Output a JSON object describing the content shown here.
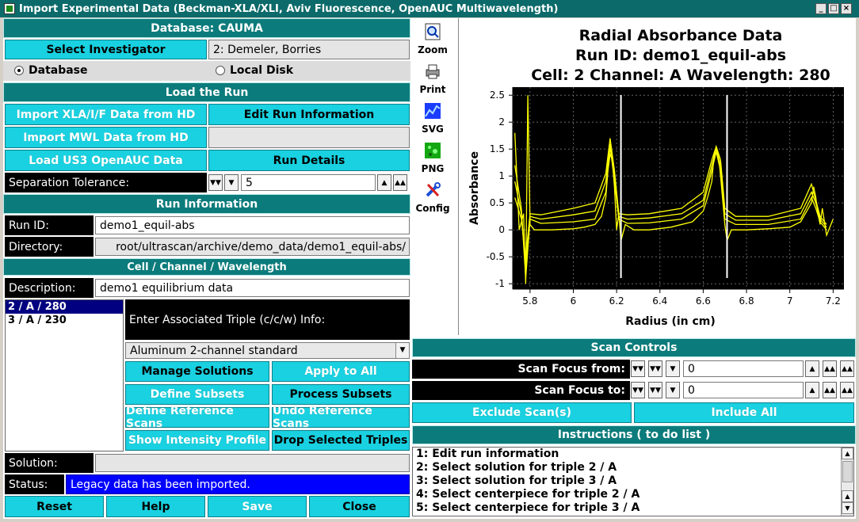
{
  "window": {
    "title": "Import Experimental Data (Beckman-XLA/XLI, Aviv Fluorescence, OpenAUC Multiwavelength)"
  },
  "left": {
    "database_header": "Database: CAUMA",
    "select_investigator": "Select Investigator",
    "investigator_value": "2: Demeler, Borries",
    "radio_database": "Database",
    "radio_local": "Local Disk",
    "load_run_header": "Load the Run",
    "import_xla": "Import XLA/I/F Data from HD",
    "edit_run_info": "Edit Run Information",
    "import_mwl": "Import MWL Data from HD",
    "load_us3": "Load US3 OpenAUC Data",
    "run_details": "Run Details",
    "separation_label": "Separation Tolerance:",
    "separation_value": "5",
    "run_info_header": "Run Information",
    "run_id_label": "Run ID:",
    "run_id_value": "demo1_equil-abs",
    "directory_label": "Directory:",
    "directory_value": "root/ultrascan/archive/demo_data/demo1_equil-abs/",
    "ccw_header": "Cell / Channel / Wavelength",
    "description_label": "Description:",
    "description_value": "demo1 equilibrium data",
    "triples": [
      "2 / A / 280",
      "3 / A / 230"
    ],
    "triple_info_label": "Enter Associated Triple (c/c/w) Info:",
    "centerpiece_value": "Aluminum 2-channel standard",
    "manage_solutions": "Manage Solutions",
    "apply_to_all": "Apply to All",
    "define_subsets": "Define Subsets",
    "process_subsets": "Process Subsets",
    "define_ref_scans": "Define Reference Scans",
    "undo_ref_scans": "Undo Reference Scans",
    "show_intensity": "Show Intensity Profile",
    "drop_triples": "Drop Selected Triples",
    "solution_label": "Solution:",
    "status_label": "Status:",
    "status_value": "Legacy data has been imported.",
    "reset": "Reset",
    "help": "Help",
    "save": "Save",
    "close": "Close"
  },
  "tools": [
    {
      "label": "Zoom",
      "icon": "zoom-icon"
    },
    {
      "label": "Print",
      "icon": "print-icon"
    },
    {
      "label": "SVG",
      "icon": "svg-icon"
    },
    {
      "label": "PNG",
      "icon": "png-icon"
    },
    {
      "label": "Config",
      "icon": "config-icon"
    }
  ],
  "right": {
    "scan_controls_header": "Scan Controls",
    "scan_from_label": "Scan Focus from:",
    "scan_from_value": "0",
    "scan_to_label": "Scan Focus to:",
    "scan_to_value": "0",
    "exclude_scans": "Exclude Scan(s)",
    "include_all": "Include All",
    "instructions_header": "Instructions ( to do list )",
    "instructions": [
      "1: Edit run information",
      "2: Select solution for triple 2 / A",
      "3: Select solution for triple 3 / A",
      "4: Select centerpiece for triple 2 / A",
      "5: Select centerpiece for triple 3 / A"
    ]
  },
  "chart_data": {
    "type": "line",
    "title_lines": [
      "Radial Absorbance Data",
      "Run ID: demo1_equil-abs",
      "Cell: 2  Channel: A  Wavelength: 280"
    ],
    "xlabel": "Radius (in cm)",
    "ylabel": "Absorbance",
    "xlim": [
      5.72,
      7.25
    ],
    "ylim": [
      -1.1,
      2.65
    ],
    "xticks": [
      5.8,
      6,
      6.2,
      6.4,
      6.6,
      6.8,
      7,
      7.2
    ],
    "yticks": [
      -1,
      -0.5,
      0,
      0.5,
      1,
      1.5,
      2,
      2.5
    ],
    "xtick_labels": [
      "5.8",
      "6",
      "6.2",
      "6.4",
      "6.6",
      "6.8",
      "7",
      "7.2"
    ],
    "ytick_labels": [
      "-1",
      "-0.5",
      "0",
      "0.5",
      "1",
      "1.5",
      "2",
      "2.5"
    ],
    "grid": true,
    "background": "#000000",
    "series_color": "#ffff00",
    "markers": [
      6.22,
      6.71
    ],
    "marker_color": "#ffffff",
    "series": [
      {
        "x": [
          5.73,
          5.75,
          5.77,
          5.78,
          5.79,
          5.8,
          5.81,
          5.82,
          5.85,
          5.9,
          6.0,
          6.05,
          6.1,
          6.13,
          6.15,
          6.16,
          6.17,
          6.18,
          6.19,
          6.2,
          6.21,
          6.22,
          6.24,
          6.26,
          6.28,
          6.3,
          6.35,
          6.45,
          6.55,
          6.6,
          6.62,
          6.64,
          6.65,
          6.66,
          6.67,
          6.68,
          6.7,
          6.71,
          6.73,
          6.75,
          6.77,
          6.8,
          6.9,
          7.0,
          7.05,
          7.1,
          7.11,
          7.12,
          7.13,
          7.14,
          7.15,
          7.17,
          7.2
        ],
        "y": [
          1.8,
          0.0,
          0.3,
          -1.0,
          2.5,
          0.1,
          0.05,
          0.0,
          0.0,
          0.0,
          0.02,
          0.05,
          0.1,
          0.25,
          0.6,
          1.1,
          1.4,
          1.3,
          0.8,
          0.0,
          0.3,
          -0.2,
          0.1,
          0.05,
          0.0,
          0.0,
          0.0,
          0.05,
          0.15,
          0.35,
          0.6,
          0.9,
          1.4,
          1.5,
          1.4,
          1.0,
          0.1,
          -0.2,
          0.0,
          0.0,
          0.0,
          0.0,
          0.02,
          0.05,
          0.15,
          0.5,
          0.8,
          0.6,
          0.3,
          0.1,
          0.4,
          -0.1,
          0.2
        ]
      },
      {
        "x": [
          5.73,
          5.76,
          5.78,
          5.8,
          5.85,
          6.0,
          6.1,
          6.15,
          6.17,
          6.19,
          6.21,
          6.25,
          6.35,
          6.5,
          6.6,
          6.64,
          6.66,
          6.68,
          6.7,
          6.75,
          6.9,
          7.05,
          7.1,
          7.12,
          7.14,
          7.17
        ],
        "y": [
          1.2,
          0.4,
          -0.9,
          0.2,
          0.12,
          0.15,
          0.2,
          0.7,
          1.55,
          0.9,
          0.2,
          0.12,
          0.13,
          0.2,
          0.45,
          1.1,
          1.45,
          1.1,
          0.2,
          0.1,
          0.1,
          0.2,
          0.6,
          0.4,
          0.15,
          0.0
        ]
      },
      {
        "x": [
          5.73,
          5.76,
          5.78,
          5.8,
          5.85,
          6.0,
          6.1,
          6.15,
          6.17,
          6.19,
          6.21,
          6.25,
          6.35,
          6.5,
          6.6,
          6.64,
          6.66,
          6.68,
          6.7,
          6.75,
          6.9,
          7.05,
          7.1,
          7.12,
          7.14,
          7.17
        ],
        "y": [
          0.9,
          0.3,
          -0.7,
          0.25,
          0.2,
          0.28,
          0.35,
          0.9,
          1.6,
          1.0,
          0.25,
          0.2,
          0.22,
          0.3,
          0.55,
          1.2,
          1.5,
          1.2,
          0.3,
          0.18,
          0.18,
          0.3,
          0.7,
          0.5,
          0.2,
          0.05
        ]
      },
      {
        "x": [
          5.73,
          5.76,
          5.78,
          5.8,
          5.85,
          6.0,
          6.1,
          6.15,
          6.17,
          6.19,
          6.21,
          6.25,
          6.35,
          6.5,
          6.6,
          6.64,
          6.66,
          6.68,
          6.7,
          6.75,
          6.9,
          7.05,
          7.1,
          7.12,
          7.14,
          7.17
        ],
        "y": [
          0.6,
          0.2,
          -0.5,
          0.3,
          0.28,
          0.4,
          0.5,
          1.05,
          1.7,
          1.1,
          0.3,
          0.28,
          0.3,
          0.4,
          0.7,
          1.3,
          1.55,
          1.3,
          0.4,
          0.25,
          0.25,
          0.4,
          0.85,
          0.55,
          0.25,
          0.1
        ]
      }
    ]
  }
}
